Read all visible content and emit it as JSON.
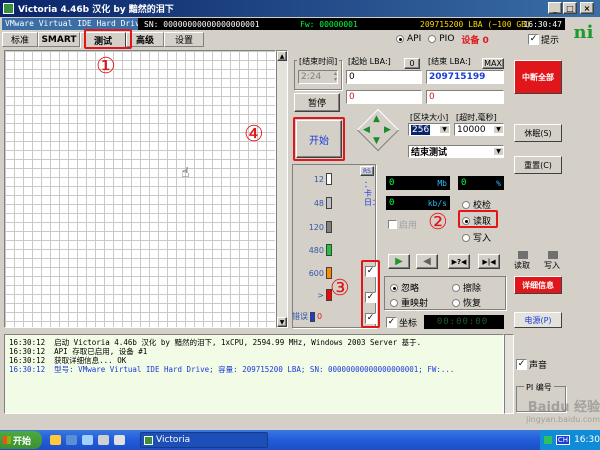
{
  "window": {
    "title": "Victoria 4.46b 汉化 by 黯然的泪下"
  },
  "status_bar": {
    "drive": "VMware Virtual IDE Hard Drive",
    "sn": "SN: 00000000000000000001",
    "fw": "Fw: 00000001",
    "lba": "209715200 LBA (~100 GB)",
    "time": "16:30:47"
  },
  "tabs": [
    {
      "label": "标准"
    },
    {
      "label": "SMART"
    },
    {
      "label": "测试"
    },
    {
      "label": "高级"
    },
    {
      "label": "设置"
    }
  ],
  "interface": {
    "api_label": "API",
    "pio_label": "PIO",
    "device_label": "设备 0",
    "hint_label": "提示"
  },
  "test_panel": {
    "end_time_label": "[结束时间]",
    "end_time_value": "2:24",
    "start_lba_label": "[起始 LBA:]",
    "start_lba_zero": "0",
    "start_lba_value": "0",
    "end_lba_label": "[结束 LBA:]",
    "end_lba_max": "MAX",
    "end_lba_value": "209715199",
    "field_zero": "0",
    "pause_label": "暂停",
    "start_label": "开始",
    "block_size_label": "[区块大小]",
    "timeout_label": "[超时,毫秒]",
    "block_size_value": "256",
    "timeout_value": "10000",
    "end_mode_value": "结束测试"
  },
  "latency": {
    "rs_label": "RS",
    "side_label": "：卡日：",
    "rows": [
      {
        "label": "12",
        "color": "#ffffff"
      },
      {
        "label": "48",
        "color": "#c0c0c0"
      },
      {
        "label": "120",
        "color": "#808080"
      },
      {
        "label": "480",
        "color": "#22c33a"
      },
      {
        "label": "600",
        "color": "#ff8a00"
      },
      {
        "label": ">",
        "color": "#ff0000"
      }
    ],
    "error_label": "错误",
    "error_value": "0"
  },
  "meters": {
    "mb_value": "0",
    "mb_unit": "Mb",
    "pct_value": "0",
    "pct_unit": "%",
    "kbs_value": "0",
    "kbs_unit": "kb/s"
  },
  "modes": {
    "enable_label": "启用",
    "verify_label": "校检",
    "read_label": "读取",
    "write_label": "写入"
  },
  "actions": {
    "ignore_label": "忽略",
    "erase_label": "擦除",
    "remap_label": "重映射",
    "restore_label": "恢复",
    "coord_label": "坐标",
    "coord_value": "00:00:00"
  },
  "right_panel": {
    "abort_label": "中断全部",
    "sleep_label": "休眠(S)",
    "reset_label": "重置(C)",
    "read_label": "读取",
    "write_label": "写入",
    "details_label": "详细信息",
    "power_label": "电源(P)",
    "sound_label": "声音",
    "pi_label": "PI 编号"
  },
  "log": [
    {
      "time": "16:30:12",
      "text": "启动 Victoria 4.46b 汉化 by 黯然的泪下, 1xCPU, 2594.99 MHz, Windows 2003 Server 基于.",
      "color": "#000000"
    },
    {
      "time": "16:30:12",
      "text": "API 存取已启用, 设备 #1",
      "color": "#000000"
    },
    {
      "time": "16:30:12",
      "text": "获取详细信息... OK",
      "color": "#000000"
    },
    {
      "time": "16:30:12",
      "text": "型号:  VMware Virtual IDE Hard Drive;    容量: 209715200 LBA; SN: 00000000000000000001; FW:...",
      "color": "#1b3cd8"
    }
  ],
  "annotations": [
    "①",
    "②",
    "③",
    "④"
  ],
  "taskbar": {
    "start_label": "开始",
    "app_label": "Victoria",
    "lang": "CH",
    "clock": "16:30"
  },
  "watermark": {
    "line1": "Baidu 经验",
    "line2": "jingyan.baidu.com"
  },
  "colors": {
    "title_bar": "#0a246a",
    "accent_red": "#e0161b",
    "lcd_text": "#00ff40",
    "taskbar": "#245edb",
    "start_button": "#3c8f34"
  }
}
